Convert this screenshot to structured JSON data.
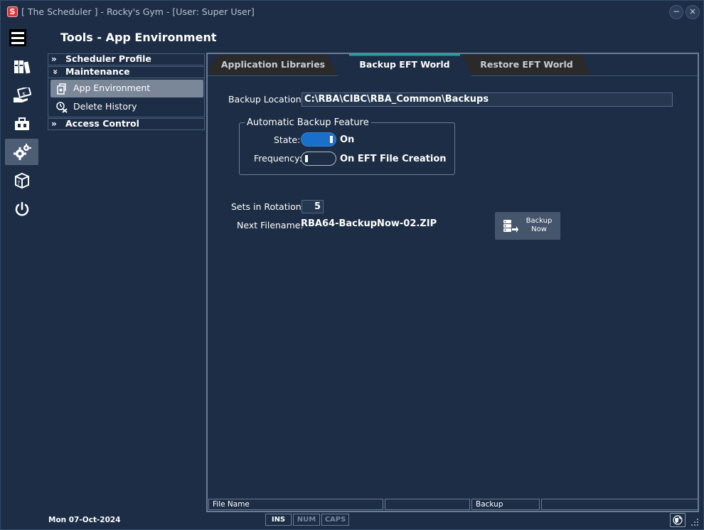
{
  "window": {
    "logo_letter": "S",
    "title": "[ The Scheduler ] - Rocky's Gym - [User: Super User]",
    "minimize_label": "−",
    "close_label": "×"
  },
  "sidebar": {
    "icons": [
      "menu-icon",
      "binders-icon",
      "money-hand-icon",
      "briefcase-icon",
      "gears-icon",
      "package-icon",
      "power-icon"
    ],
    "active_index": 4
  },
  "page": {
    "title": "Tools - App Environment"
  },
  "nav": {
    "groups": [
      {
        "label": "Scheduler Profile",
        "expanded": false
      },
      {
        "label": "Maintenance",
        "expanded": true
      },
      {
        "label": "Access Control",
        "expanded": false
      }
    ],
    "maintenance_items": [
      {
        "label": "App Environment",
        "selected": true
      },
      {
        "label": "Delete History",
        "selected": false
      }
    ],
    "chev_collapsed": "»",
    "chev_expanded": "»"
  },
  "tabs": [
    {
      "label": "Application Libraries",
      "active": false
    },
    {
      "label": "Backup EFT World",
      "active": true
    },
    {
      "label": "Restore EFT World",
      "active": false
    }
  ],
  "form": {
    "backup_location_label": "Backup Location:",
    "backup_location_value": "C:\\RBA\\CIBC\\RBA_Common\\Backups",
    "auto_backup_legend": "Automatic Backup Feature",
    "state_label": "State:",
    "state_value": "On",
    "state_on": true,
    "frequency_label": "Frequency:",
    "frequency_value": "On EFT File Creation",
    "frequency_on": false,
    "sets_label": "Sets in Rotation:",
    "sets_value": "5",
    "next_filename_label": "Next Filename:",
    "next_filename_value": "RBA64-BackupNow-02.ZIP",
    "backup_button_line1": "Backup",
    "backup_button_line2": "Now"
  },
  "status_cells": [
    {
      "label": "File Name"
    },
    {
      "label": ""
    },
    {
      "label": ""
    },
    {
      "label": "Backup"
    },
    {
      "label": ""
    }
  ],
  "footer": {
    "date": "Mon  07-Oct-2024",
    "ins": "INS",
    "num": "NUM",
    "caps": "CAPS"
  },
  "colors": {
    "background": "#1c2d45",
    "accent_blue": "#1a6fc9",
    "tab_active_top": "#1ba7a0",
    "selected_item": "#7a8799"
  }
}
